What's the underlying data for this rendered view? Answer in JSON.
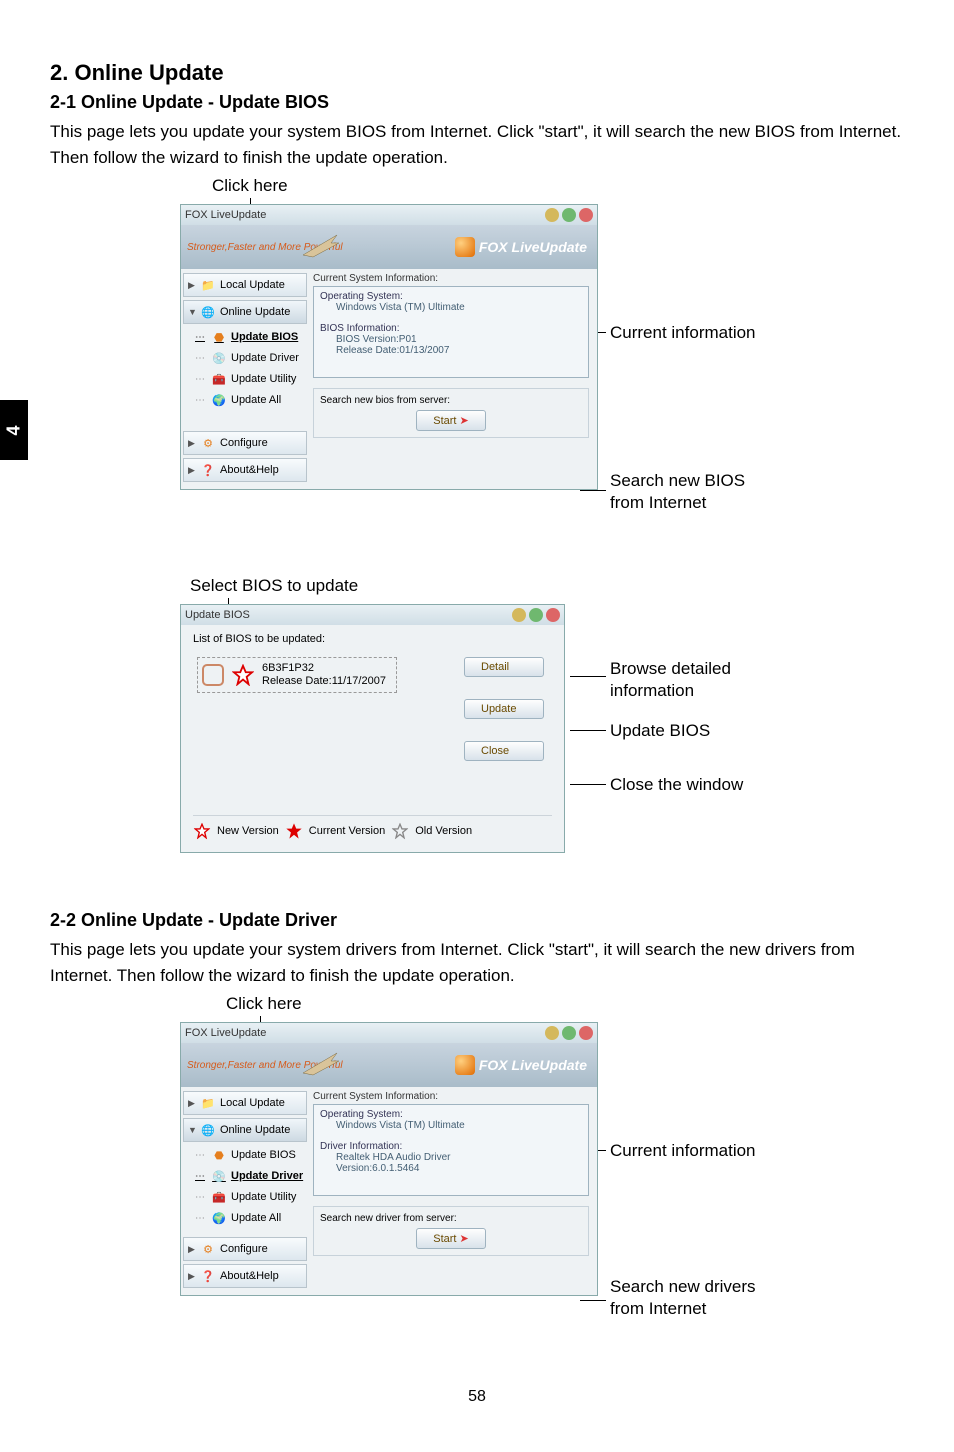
{
  "page": {
    "tab_number": "4",
    "page_number": "58",
    "h2": "2. Online Update",
    "h3_1": "2-1 Online Update - Update BIOS",
    "p1": "This page lets you update your system BIOS from Internet. Click \"start\", it will search the new BIOS from Internet. Then follow the wizard to finish the update operation.",
    "click_here": "Click here",
    "callout_current_info": "Current information",
    "callout_search_bios_l1": "Search new BIOS",
    "callout_search_bios_l2": "from Internet",
    "select_bios_label": "Select BIOS to update",
    "callout_detail_l1": "Browse detailed",
    "callout_detail_l2": "information",
    "callout_update": "Update BIOS",
    "callout_close": "Close the window",
    "h3_2": "2-2 Online Update - Update Driver",
    "p2": "This page lets you update your system drivers from Internet. Click \"start\", it will search the new drivers from Internet. Then follow the wizard to finish the update operation.",
    "callout_search_drv_l1": "Search new drivers",
    "callout_search_drv_l2": "from Internet"
  },
  "app1": {
    "title": "FOX LiveUpdate",
    "tagline": "Stronger,Faster and More Powerful",
    "brand": "FOX LiveUpdate",
    "sidebar": {
      "local": "Local Update",
      "online": "Online Update",
      "bios": "Update BIOS",
      "driver": "Update Driver",
      "utility": "Update Utility",
      "all": "Update All",
      "configure": "Configure",
      "about": "About&Help"
    },
    "content": {
      "header": "Current System Information:",
      "os_h": "Operating System:",
      "os_v": "Windows Vista (TM) Ultimate",
      "bios_h": "BIOS Information:",
      "bios_ver": "BIOS Version:P01",
      "bios_date": "Release Date:01/13/2007",
      "search_label": "Search new bios from server:",
      "start": "Start"
    }
  },
  "dialog": {
    "title": "Update BIOS",
    "list_label": "List of BIOS to be updated:",
    "entry_name": "6B3F1P32",
    "entry_date": "Release Date:11/17/2007",
    "btn_detail": "Detail",
    "btn_update": "Update",
    "btn_close": "Close",
    "legend_new": "New Version",
    "legend_cur": "Current Version",
    "legend_old": "Old Version"
  },
  "app2": {
    "title": "FOX LiveUpdate",
    "tagline": "Stronger,Faster and More Powerful",
    "brand": "FOX LiveUpdate",
    "sidebar": {
      "local": "Local Update",
      "online": "Online Update",
      "bios": "Update BIOS",
      "driver": "Update Driver",
      "utility": "Update Utility",
      "all": "Update All",
      "configure": "Configure",
      "about": "About&Help"
    },
    "content": {
      "header": "Current System Information:",
      "os_h": "Operating System:",
      "os_v": "Windows Vista (TM) Ultimate",
      "drv_h": "Driver Information:",
      "drv_name": "Realtek HDA Audio Driver",
      "drv_ver": "Version:6.0.1.5464",
      "search_label": "Search new driver from server:",
      "start": "Start"
    }
  }
}
